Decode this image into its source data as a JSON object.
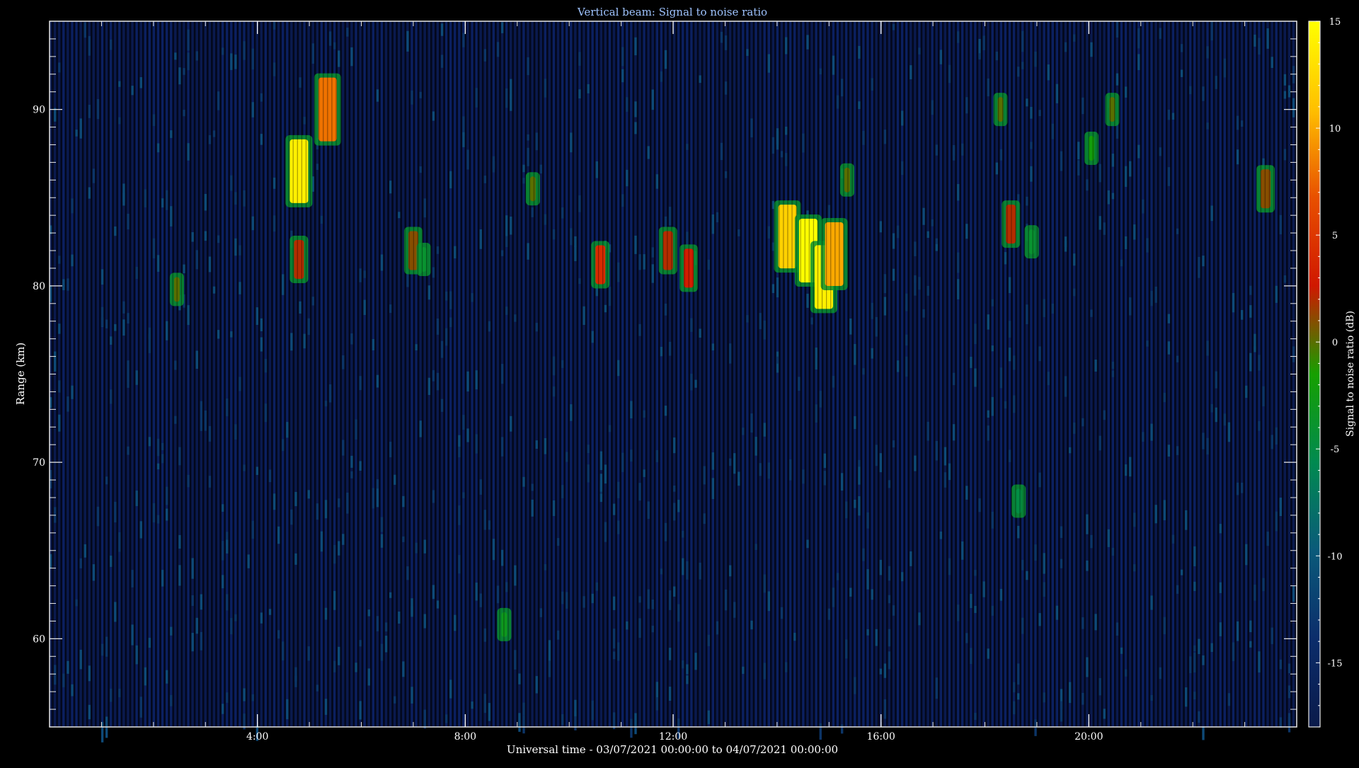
{
  "chart_data": {
    "type": "heatmap",
    "title": "Vertical beam: Signal to noise ratio",
    "xlabel": "Universal time - 03/07/2021 00:00:00 to 04/07/2021 00:00:00",
    "ylabel": "Range (km)",
    "xlim": [
      0,
      24
    ],
    "ylim": [
      55,
      95
    ],
    "x_ticks": [
      {
        "value": 4,
        "label": "4:00"
      },
      {
        "value": 8,
        "label": "8:00"
      },
      {
        "value": 12,
        "label": "12:00"
      },
      {
        "value": 16,
        "label": "16:00"
      },
      {
        "value": 20,
        "label": "20:00"
      }
    ],
    "y_ticks": [
      {
        "value": 60,
        "label": "60"
      },
      {
        "value": 70,
        "label": "70"
      },
      {
        "value": 80,
        "label": "80"
      },
      {
        "value": 90,
        "label": "90"
      }
    ],
    "colorbar": {
      "label": "Signal to noise ratio (dB)",
      "range": [
        -18,
        15
      ],
      "ticks": [
        {
          "value": 15,
          "label": "15"
        },
        {
          "value": 10,
          "label": "10"
        },
        {
          "value": 5,
          "label": "5"
        },
        {
          "value": 0,
          "label": "0"
        },
        {
          "value": -5,
          "label": "-5"
        },
        {
          "value": -10,
          "label": "-10"
        },
        {
          "value": -15,
          "label": "-15"
        }
      ],
      "colors": [
        "#0a1a4a",
        "#0b2d6b",
        "#0a5a7a",
        "#008a50",
        "#16a000",
        "#d01800",
        "#e85000",
        "#ffc000",
        "#ffff00"
      ]
    },
    "background_snr": -15,
    "features": [
      {
        "time": 10.6,
        "range": 81.2,
        "snr": 4
      },
      {
        "time": 11.9,
        "range": 82.0,
        "snr": 2
      },
      {
        "time": 12.3,
        "range": 81.0,
        "snr": 3
      },
      {
        "time": 14.2,
        "range": 82.8,
        "snr": 12
      },
      {
        "time": 14.6,
        "range": 82.0,
        "snr": 15
      },
      {
        "time": 14.9,
        "range": 80.5,
        "snr": 14
      },
      {
        "time": 15.1,
        "range": 81.8,
        "snr": 10
      },
      {
        "time": 18.5,
        "range": 83.5,
        "snr": 2
      },
      {
        "time": 18.9,
        "range": 82.5,
        "snr": -4
      },
      {
        "time": 4.8,
        "range": 86.5,
        "snr": 14
      },
      {
        "time": 4.8,
        "range": 81.5,
        "snr": 2
      },
      {
        "time": 5.35,
        "range": 90.0,
        "snr": 8
      },
      {
        "time": 7.0,
        "range": 82.0,
        "snr": 1
      },
      {
        "time": 7.2,
        "range": 81.5,
        "snr": -4
      },
      {
        "time": 2.45,
        "range": 79.8,
        "snr": 0
      },
      {
        "time": 9.3,
        "range": 85.5,
        "snr": 0
      },
      {
        "time": 15.35,
        "range": 86.0,
        "snr": 0
      },
      {
        "time": 18.3,
        "range": 90.0,
        "snr": 0
      },
      {
        "time": 20.45,
        "range": 90.0,
        "snr": 0
      },
      {
        "time": 23.4,
        "range": 85.5,
        "snr": 1
      },
      {
        "time": 20.05,
        "range": 87.8,
        "snr": -2
      },
      {
        "time": 8.75,
        "range": 60.8,
        "snr": -3
      },
      {
        "time": 18.65,
        "range": 67.8,
        "snr": -5
      }
    ]
  }
}
